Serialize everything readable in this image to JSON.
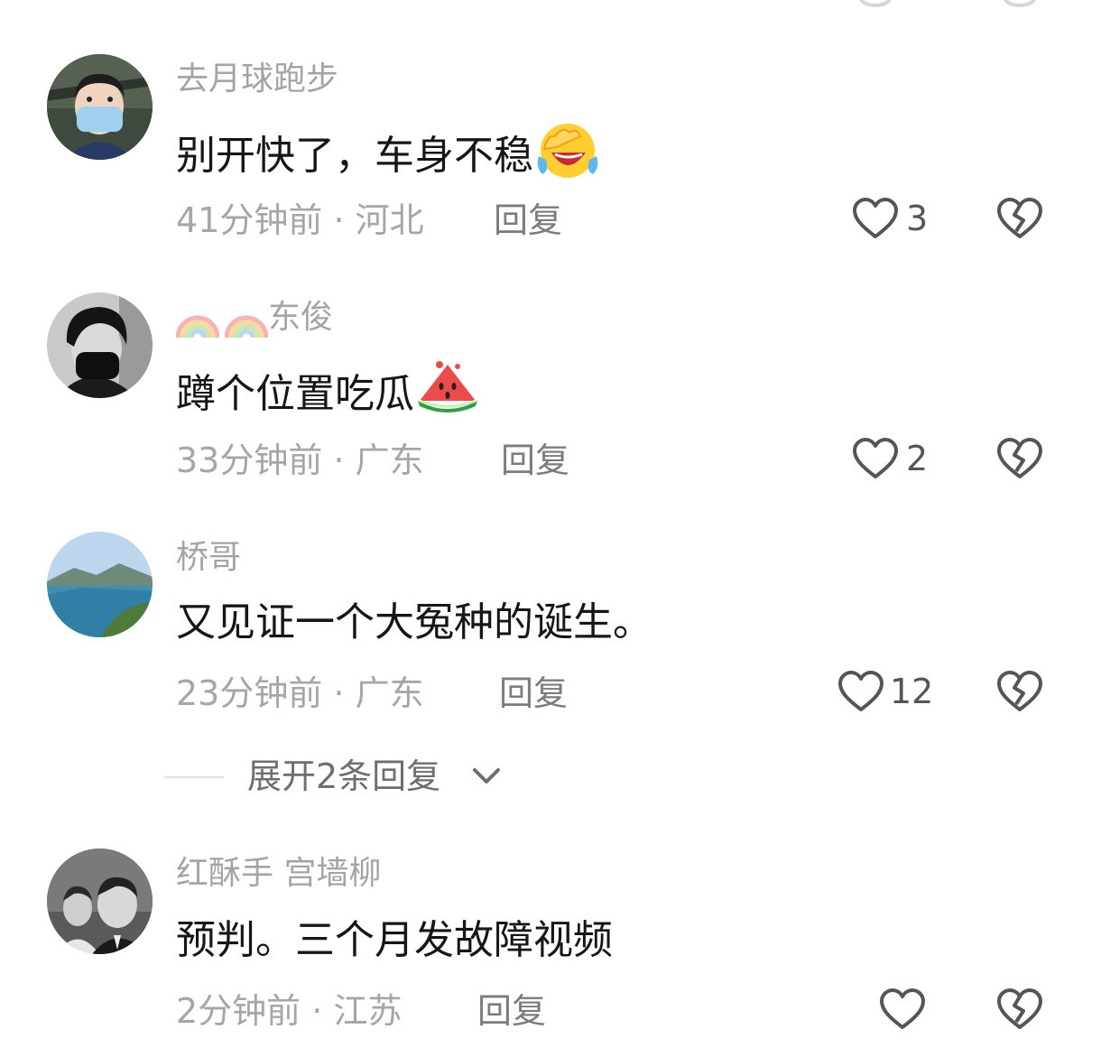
{
  "comments": [
    {
      "username": "去月球跑步",
      "text": "别开快了，车身不稳",
      "emoji": "face-with-tears-of-joy-icon",
      "time": "41分钟前",
      "location": "河北",
      "reply_label": "回复",
      "likes": "3"
    },
    {
      "username": "东俊",
      "username_emoji": "rainbow-icon",
      "text": "蹲个位置吃瓜",
      "emoji": "watermelon-icon",
      "time": "33分钟前",
      "location": "广东",
      "reply_label": "回复",
      "likes": "2"
    },
    {
      "username": "桥哥",
      "text": "又见证一个大冤种的诞生。",
      "time": "23分钟前",
      "location": "广东",
      "reply_label": "回复",
      "likes": "12"
    },
    {
      "username": "红酥手 宫墙柳",
      "text": "预判。三个月发故障视频",
      "time": "2分钟前",
      "location": "江苏",
      "reply_label": "回复",
      "likes": ""
    }
  ],
  "expand_replies": {
    "label": "展开2条回复"
  },
  "separator": " · ",
  "colors": {
    "username": "#a4a4a4",
    "text": "#161616",
    "meta": "#a6a6a6",
    "reply": "#7c7c7c",
    "icon": "#555555"
  }
}
